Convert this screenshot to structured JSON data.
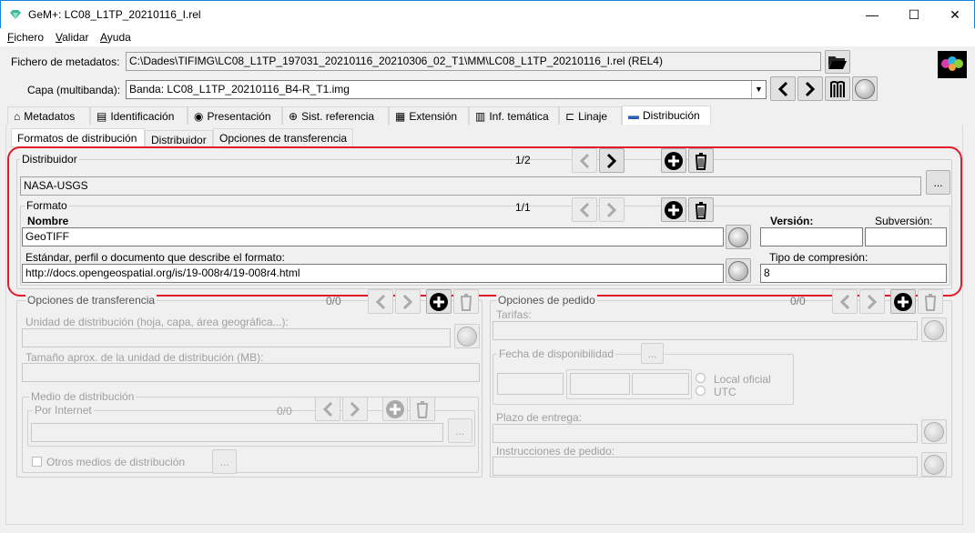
{
  "window": {
    "title": "GeM+: LC08_L1TP_20210116_I.rel",
    "minimize": "—",
    "maximize": "☐",
    "close": "✕"
  },
  "menu": {
    "items": [
      {
        "label": "Fichero",
        "u": "F",
        "rest": "ichero"
      },
      {
        "label": "Validar",
        "u": "V",
        "rest": "alidar"
      },
      {
        "label": "Ayuda",
        "u": "A",
        "rest": "yuda"
      }
    ]
  },
  "metadata_file": {
    "label": "Fichero de metadatos:",
    "value": "C:\\Dades\\TIFIMG\\LC08_L1TP_197031_20210116_20210306_02_T1\\MM\\LC08_L1TP_20210116_I.rel (REL4)"
  },
  "layer": {
    "label": "Capa (multibanda):",
    "value": "Banda: LC08_L1TP_20210116_B4-R_T1.img"
  },
  "main_tabs": [
    "Metadatos",
    "Identificación",
    "Presentación",
    "Sist. referencia",
    "Extensión",
    "Inf. temática",
    "Linaje",
    "Distribución"
  ],
  "sub_tabs": [
    "Formatos de distribución",
    "Distribuidor",
    "Opciones de transferencia"
  ],
  "distributor": {
    "legend": "Distribuidor",
    "counter": "1/2",
    "value": "NASA-USGS",
    "more": "..."
  },
  "format": {
    "legend": "Formato",
    "counter": "1/1",
    "name_label": "Nombre",
    "name_value": "GeoTIFF",
    "version_label": "Versión:",
    "version_value": "",
    "subversion_label": "Subversión:",
    "subversion_value": "",
    "standard_label": "Estándar, perfil o documento que describe el formato:",
    "standard_value": "http://docs.opengeospatial.org/is/19-008r4/19-008r4.html",
    "compression_label": "Tipo de compresión:",
    "compression_value": "8"
  },
  "transfer_options": {
    "legend": "Opciones de transferencia",
    "counter": "0/0",
    "unit_label": "Unidad de distribución (hoja, capa, área geográfica...):",
    "size_label": "Tamaño aprox. de la unidad de distribución (MB):",
    "medium_legend": "Medio de distribución",
    "internet_legend": "Por Internet",
    "internet_counter": "0/0",
    "other_media_label": "Otros medios de distribución",
    "more": "..."
  },
  "order_options": {
    "legend": "Opciones de pedido",
    "counter": "0/0",
    "fees_label": "Tarifas:",
    "availability_legend": "Fecha de disponibilidad",
    "more": "...",
    "local_label": "Local oficial",
    "utc_label": "UTC",
    "delivery_label": "Plazo de entrega:",
    "instructions_label": "Instrucciones de pedido:"
  }
}
